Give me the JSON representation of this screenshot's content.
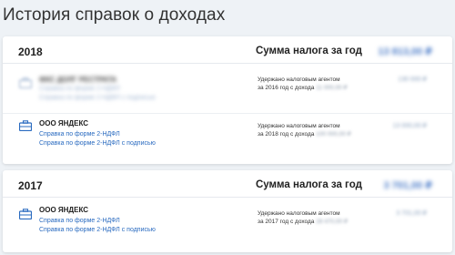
{
  "page": {
    "title": "История справок о доходах"
  },
  "labels": {
    "tax_sum": "Сумма налога за год"
  },
  "colors": {
    "accent": "#2a6bc0",
    "background": "#eef2f6",
    "card": "#ffffff"
  },
  "years": [
    {
      "year": "2018",
      "tax_total": "13 813,00 ₽",
      "items": [
        {
          "org": "ФКС ДОЛГ РЕСТРАТА",
          "link1": "Справка по форме 2-НДФЛ",
          "link2": "Справка по форме 2-НДФЛ с подписью",
          "agent_line1": "Удержано налоговым агентом",
          "agent_line2_prefix": "за 2016 год с дохода",
          "agent_income": "11 000,00 ₽",
          "amount": "130 000 ₽",
          "icon": "briefcase-icon",
          "obscured": true
        },
        {
          "org": "ООО ЯНДЕКС",
          "link1": "Справка по форме 2-НДФЛ",
          "link2": "Справка по форме 2-НДФЛ с подписью",
          "agent_line1": "Удержано налоговым агентом",
          "agent_line2_prefix": "за 2018 год с дохода",
          "agent_income": "100 000,00 ₽",
          "amount": "13 000,00 ₽",
          "icon": "briefcase-icon",
          "obscured": false
        }
      ]
    },
    {
      "year": "2017",
      "tax_total": "3 701,00 ₽",
      "items": [
        {
          "org": "ООО ЯНДЕКС",
          "link1": "Справка по форме 2-НДФЛ",
          "link2": "Справка по форме 2-НДФЛ с подписью",
          "agent_line1": "Удержано налоговым агентом",
          "agent_line2_prefix": "за 2017 год с дохода",
          "agent_income": "28 470,00 ₽",
          "amount": "3 701,00 ₽",
          "icon": "briefcase-icon",
          "obscured": false
        }
      ]
    }
  ]
}
